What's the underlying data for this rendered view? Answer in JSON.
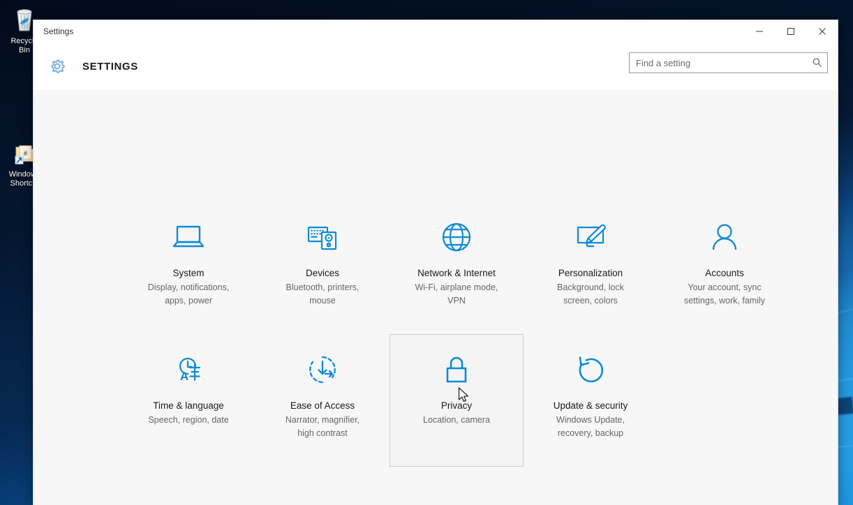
{
  "desktop": {
    "icons": [
      {
        "name": "recycle-bin",
        "label": "Recycle\nBin"
      },
      {
        "name": "windows-shortcut",
        "label": "Windows\nShortcut"
      }
    ]
  },
  "window": {
    "titlebar": {
      "title": "Settings",
      "minimize_label": "Minimize",
      "maximize_label": "Maximize",
      "close_label": "Close"
    },
    "header": {
      "gear_icon": "gear-icon",
      "title": "SETTINGS"
    },
    "search": {
      "placeholder": "Find a setting",
      "value": "",
      "icon": "search-icon"
    }
  },
  "colors": {
    "accent": "#0078d7",
    "accent_light": "#5aaae0",
    "title_text": "#1a1a1a",
    "desc_text": "#666666",
    "window_bg": "#f7f7f7",
    "hover_border": "#cccccc"
  },
  "tiles": {
    "row1": [
      {
        "name": "system",
        "icon": "laptop-icon",
        "title": "System",
        "desc": "Display, notifications,\napps, power",
        "hovered": false
      },
      {
        "name": "devices",
        "icon": "keyboard-speaker-icon",
        "title": "Devices",
        "desc": "Bluetooth, printers,\nmouse",
        "hovered": false
      },
      {
        "name": "network-internet",
        "icon": "globe-icon",
        "title": "Network & Internet",
        "desc": "Wi-Fi, airplane mode,\nVPN",
        "hovered": false
      },
      {
        "name": "personalization",
        "icon": "monitor-brush-icon",
        "title": "Personalization",
        "desc": "Background, lock\nscreen, colors",
        "hovered": false
      },
      {
        "name": "accounts",
        "icon": "person-icon",
        "title": "Accounts",
        "desc": "Your account, sync\nsettings, work, family",
        "hovered": false
      }
    ],
    "row2": [
      {
        "name": "time-language",
        "icon": "clock-language-icon",
        "title": "Time & language",
        "desc": "Speech, region, date",
        "hovered": false
      },
      {
        "name": "ease-of-access",
        "icon": "clock-arrow-icon",
        "title": "Ease of Access",
        "desc": "Narrator, magnifier,\nhigh contrast",
        "hovered": false
      },
      {
        "name": "privacy",
        "icon": "lock-icon",
        "title": "Privacy",
        "desc": "Location, camera",
        "hovered": true
      },
      {
        "name": "update-security",
        "icon": "refresh-icon",
        "title": "Update & security",
        "desc": "Windows Update,\nrecovery, backup",
        "hovered": false
      }
    ]
  }
}
